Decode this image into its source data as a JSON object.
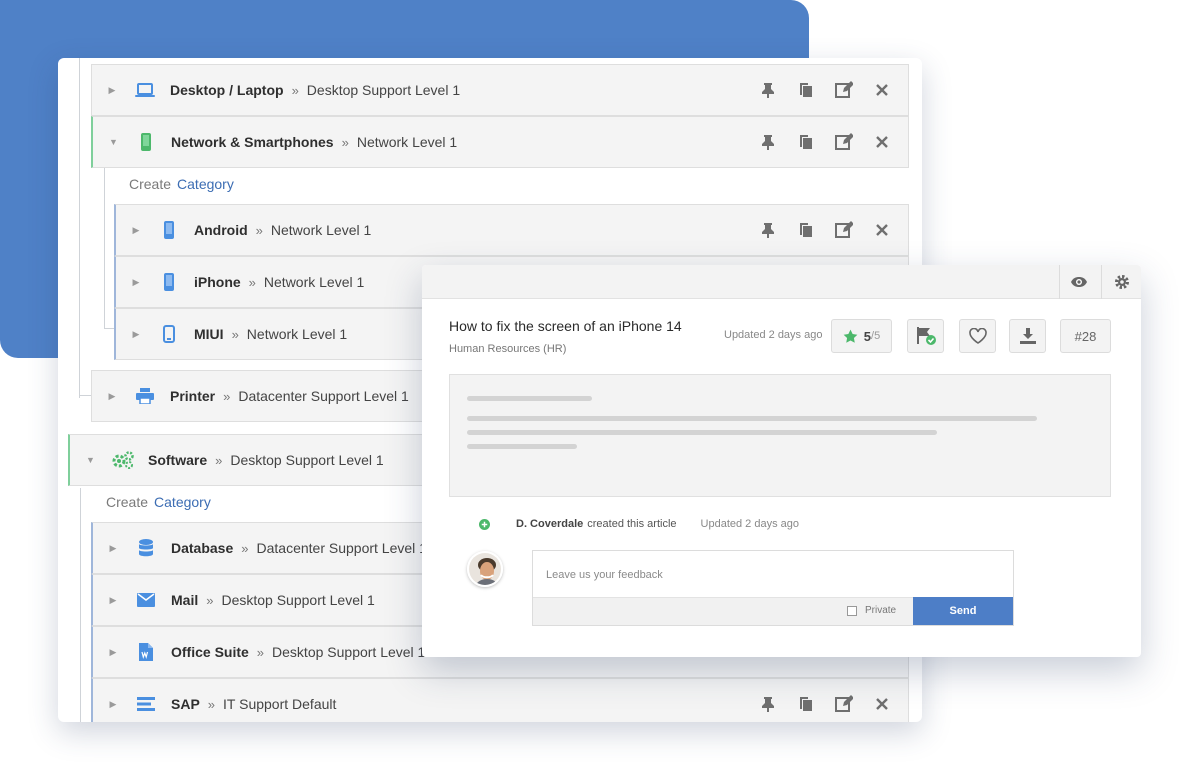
{
  "tree": {
    "rows": [
      {
        "name": "Desktop / Laptop",
        "sep": "»",
        "level": "Desktop Support Level 1"
      },
      {
        "name": "Network & Smartphones",
        "sep": "»",
        "level": "Network Level 1"
      },
      {
        "name": "Android",
        "sep": "»",
        "level": "Network Level 1"
      },
      {
        "name": "iPhone",
        "sep": "»",
        "level": "Network Level 1"
      },
      {
        "name": "MIUI",
        "sep": "»",
        "level": "Network Level 1"
      },
      {
        "name": "Printer",
        "sep": "»",
        "level": "Datacenter Support Level 1"
      },
      {
        "name": "Software",
        "sep": "»",
        "level": "Desktop Support Level 1"
      },
      {
        "name": "Database",
        "sep": "»",
        "level": "Datacenter Support Level 1"
      },
      {
        "name": "Mail",
        "sep": "»",
        "level": "Desktop Support Level 1"
      },
      {
        "name": "Office Suite",
        "sep": "»",
        "level": "Desktop Support Level 1"
      },
      {
        "name": "SAP",
        "sep": "»",
        "level": "IT Support Default"
      }
    ],
    "create_label": "Create",
    "category_link": "Category"
  },
  "article": {
    "title": "How to fix the screen of an iPhone 14",
    "subtitle": "Human Resources (HR)",
    "updated": "Updated 2 days ago",
    "rating_value": "5",
    "rating_max": "/5",
    "id": "#28"
  },
  "activity": {
    "author": "D. Coverdale",
    "action": "created this article",
    "time": "Updated 2 days ago"
  },
  "feedback": {
    "placeholder": "Leave us your feedback",
    "private_label": "Private",
    "send_label": "Send"
  },
  "colors": {
    "background_blue": "#4f81c7",
    "accent_green": "#4cb86b",
    "icon_blue": "#4a8fe0",
    "send_blue": "#4d7ec7"
  }
}
